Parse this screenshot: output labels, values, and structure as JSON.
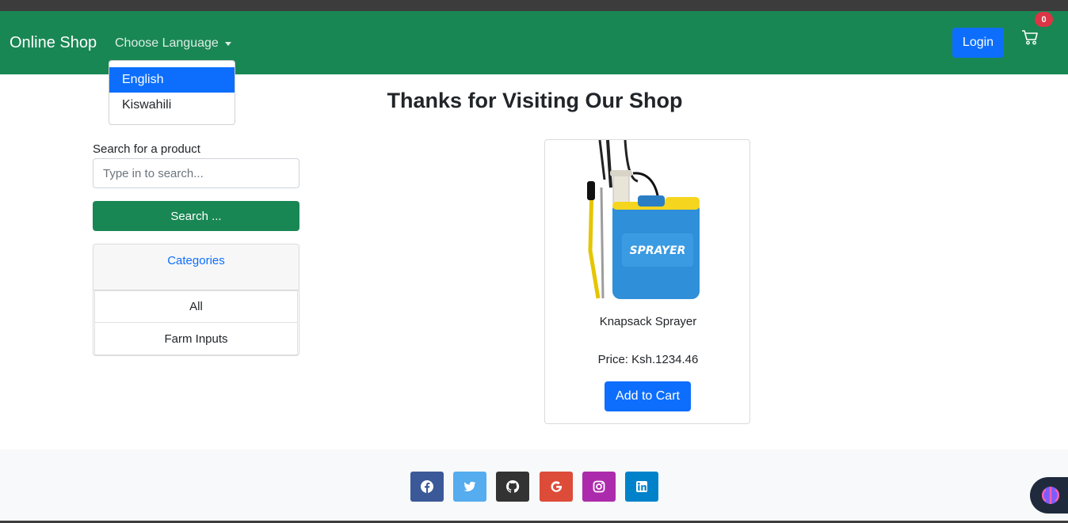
{
  "navbar": {
    "brand": "Online Shop",
    "language_toggle": "Choose Language",
    "login_label": "Login",
    "cart_count": "0",
    "colors": {
      "navbar": "#198754",
      "login": "#0d6efd",
      "badge": "#dc3545"
    }
  },
  "language_menu": {
    "items": [
      "English",
      "Kiswahili"
    ],
    "selected": "English"
  },
  "main": {
    "title": "Thanks for Visiting Our Shop"
  },
  "search": {
    "label": "Search for a product",
    "placeholder": "Type in to search...",
    "value": "",
    "button_label": "Search ..."
  },
  "categories": {
    "header": "Categories",
    "items": [
      "All",
      "Farm Inputs"
    ]
  },
  "product": {
    "name": "Knapsack Sprayer",
    "price": "Price: Ksh.1234.46",
    "image_text": "SPRAYER",
    "add_to_cart_label": "Add to Cart"
  },
  "footer": {
    "social": [
      {
        "icon": "facebook-icon",
        "color": "#3b5998"
      },
      {
        "icon": "twitter-icon",
        "color": "#55acee"
      },
      {
        "icon": "github-icon",
        "color": "#333333"
      },
      {
        "icon": "google-icon",
        "color": "#dd4b39"
      },
      {
        "icon": "instagram-icon",
        "color": "#ac2bac"
      },
      {
        "icon": "linkedin-icon",
        "color": "#0082ca"
      }
    ]
  }
}
